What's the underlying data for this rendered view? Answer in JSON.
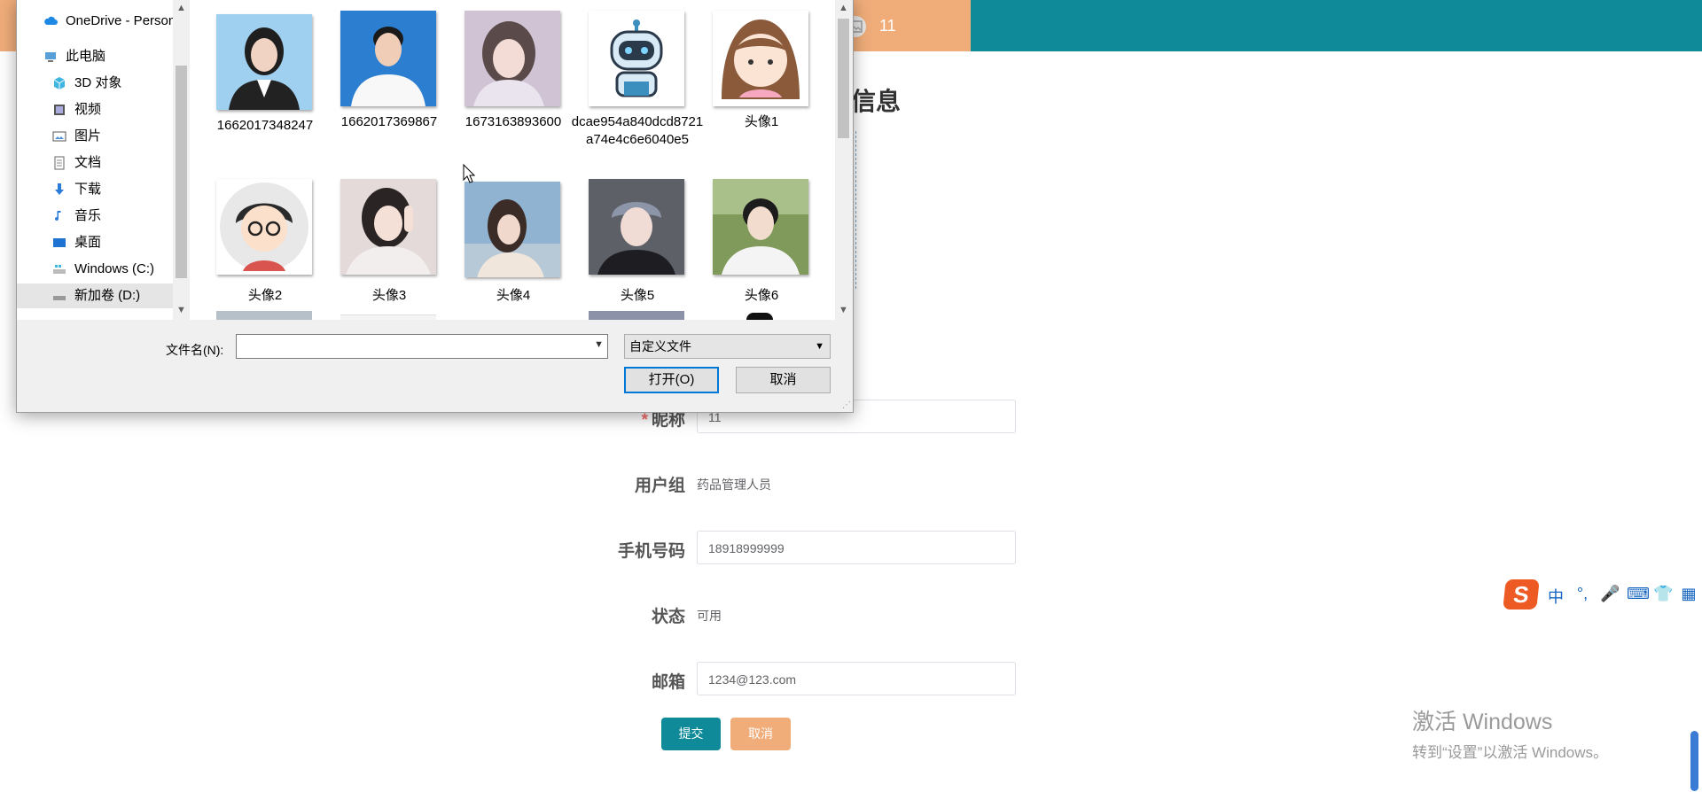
{
  "topbar": {
    "user_name": "11"
  },
  "page": {
    "title": "信息",
    "form": {
      "nickname": {
        "label": "昵称",
        "required_mark": "*",
        "value": "11"
      },
      "user_group": {
        "label": "用户组",
        "value": "药品管理人员"
      },
      "phone": {
        "label": "手机号码",
        "value": "18918999999"
      },
      "status": {
        "label": "状态",
        "value": "可用"
      },
      "email": {
        "label": "邮箱",
        "value": "1234@123.com"
      }
    },
    "submit_label": "提交",
    "cancel_label": "取消"
  },
  "watermark": {
    "line1": "激活 Windows",
    "line2": "转到“设置”以激活 Windows。"
  },
  "ime": {
    "logo": "S",
    "items": [
      "中",
      "°,",
      "🎤",
      "⌨",
      "👕",
      "▦"
    ]
  },
  "dialog": {
    "nav": [
      {
        "label": "OneDrive - Personal",
        "icon": "cloud-icon"
      },
      {
        "label": "此电脑",
        "icon": "computer-icon"
      },
      {
        "label": "3D 对象",
        "icon": "cube-icon"
      },
      {
        "label": "视频",
        "icon": "video-icon"
      },
      {
        "label": "图片",
        "icon": "picture-icon"
      },
      {
        "label": "文档",
        "icon": "document-icon"
      },
      {
        "label": "下载",
        "icon": "download-icon"
      },
      {
        "label": "音乐",
        "icon": "music-icon"
      },
      {
        "label": "桌面",
        "icon": "desktop-icon"
      },
      {
        "label": "Windows (C:)",
        "icon": "drive-c-icon"
      },
      {
        "label": "新加卷 (D:)",
        "icon": "drive-d-icon"
      }
    ],
    "files": [
      {
        "name": "1662017348247",
        "thumb": "photo-woman-blue"
      },
      {
        "name": "1662017369867",
        "thumb": "photo-man-blue"
      },
      {
        "name": "1673163893600",
        "thumb": "photo-girl-lilac"
      },
      {
        "name": "dcae954a840dcd8721a74e4c6e6040e5",
        "thumb": "robot-icon"
      },
      {
        "name": "头像1",
        "thumb": "cartoon-girl"
      },
      {
        "name": "头像2",
        "thumb": "cartoon-boy-glasses"
      },
      {
        "name": "头像3",
        "thumb": "photo-girl-pose"
      },
      {
        "name": "头像4",
        "thumb": "photo-girl-sky"
      },
      {
        "name": "头像5",
        "thumb": "photo-boy-dark"
      },
      {
        "name": "头像6",
        "thumb": "photo-boy-park"
      }
    ],
    "filename_label": "文件名(N):",
    "filename_value": "",
    "filter_value": "自定义文件",
    "open_label": "打开(O)",
    "cancel_label": "取消"
  }
}
